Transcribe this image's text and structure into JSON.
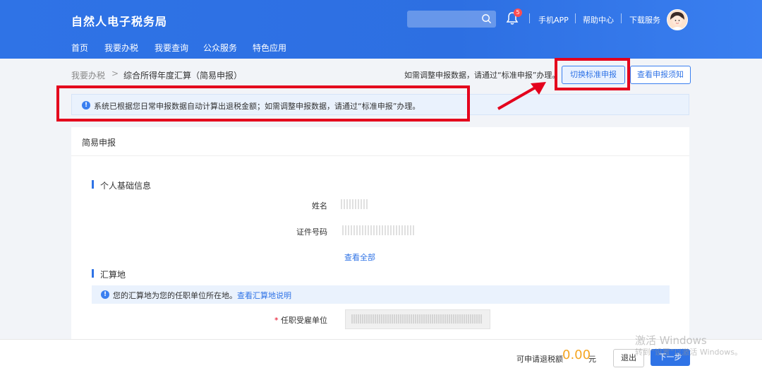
{
  "header": {
    "site_title": "自然人电子税务局",
    "search": {
      "value": "",
      "placeholder": ""
    },
    "notification_count": "5",
    "links": [
      "手机APP",
      "帮助中心",
      "下载服务"
    ],
    "nav": [
      "首页",
      "我要办税",
      "我要查询",
      "公众服务",
      "特色应用"
    ]
  },
  "breadcrumb": {
    "parent": "我要办税",
    "separator": ">",
    "current": "综合所得年度汇算（简易申报）"
  },
  "toolbar": {
    "hint": "如需调整申报数据，请通过“标准申报”办理。",
    "switch_label": "切换标准申报",
    "notice_label": "查看申报须知"
  },
  "info_banner": {
    "text": "系统已根据您日常申报数据自动计算出退税金额；如需调整申报数据，请通过“标准申报”办理。"
  },
  "card": {
    "title": "简易申报",
    "personal": {
      "title": "个人基础信息",
      "name_label": "姓名",
      "id_label": "证件号码",
      "view_all": "查看全部"
    },
    "settlement": {
      "title": "汇算地",
      "banner_text": "您的汇算地为您的任职单位所在地。",
      "banner_link": "查看汇算地说明",
      "required_mark": "*",
      "employer_label": "任职受雇单位"
    }
  },
  "footer": {
    "refund_label": "可申请退税额",
    "refund_amount": "0.00",
    "refund_unit": "元",
    "exit_label": "退出",
    "next_label": "下一步"
  },
  "watermark": {
    "line1": "激活 Windows",
    "line2": "转到“设置”以激活 Windows。"
  },
  "colors": {
    "header_blue": "#2f73e6",
    "accent": "#2f73e6",
    "annotation_red": "#e4001c",
    "refund_amount": "#f5a623"
  }
}
